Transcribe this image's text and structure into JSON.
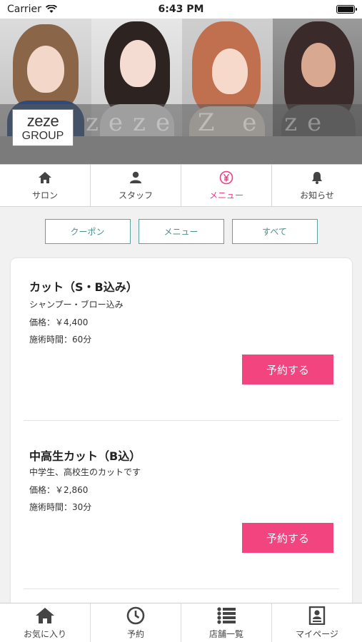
{
  "status_bar": {
    "carrier": "Carrier",
    "time": "6:43 PM"
  },
  "banner": {
    "logo_line1": "zeze",
    "logo_line2": "GROUP",
    "watermark": "zeze Z e ze"
  },
  "tabs": [
    {
      "label": "サロン",
      "icon": "home-icon",
      "active": false
    },
    {
      "label": "スタッフ",
      "icon": "person-icon",
      "active": false
    },
    {
      "label": "メニュー",
      "icon": "yen-icon",
      "active": true
    },
    {
      "label": "お知らせ",
      "icon": "bell-icon",
      "active": false
    }
  ],
  "filters": [
    {
      "label": "クーポン"
    },
    {
      "label": "メニュー"
    },
    {
      "label": "すべて"
    }
  ],
  "menu_items": [
    {
      "name": "カット（S・B込み）",
      "description": "シャンプー・ブロー込み",
      "price": "価格：￥4,400",
      "duration": "施術時間：60分",
      "button": "予約する"
    },
    {
      "name": "中高生カット（B込）",
      "description": "中学生、高校生のカットです",
      "price": "価格：￥2,860",
      "duration": "施術時間：30分",
      "button": "予約する"
    }
  ],
  "bottom_tabs": [
    {
      "label": "お気に入り",
      "icon": "home-icon"
    },
    {
      "label": "予約",
      "icon": "clock-icon"
    },
    {
      "label": "店舗一覧",
      "icon": "list-icon"
    },
    {
      "label": "マイページ",
      "icon": "profile-card-icon"
    }
  ],
  "colors": {
    "accent": "#ee3e85",
    "reserve_button": "#f2457f",
    "filter_border": "#5ba2a0"
  }
}
